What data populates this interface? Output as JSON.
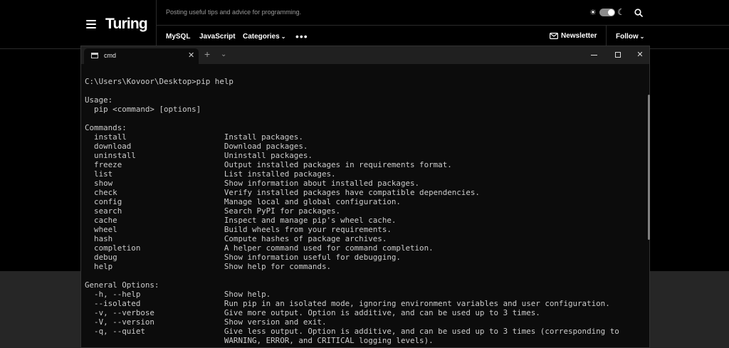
{
  "header": {
    "logo": "Turing",
    "tagline": "Posting useful tips and advice for programming.",
    "nav": [
      "MySQL",
      "JavaScript",
      "Categories"
    ],
    "newsletter_label": "Newsletter",
    "follow_label": "Follow"
  },
  "icons": {
    "menu": "hamburger-icon",
    "theme": [
      "sun-icon",
      "moon-icon"
    ],
    "search": "search-icon",
    "more": "more-icon",
    "mail": "mail-icon"
  },
  "terminal": {
    "tab_title": "cmd",
    "prompt": "C:\\Users\\Kovoor\\Desktop>pip help",
    "usage_heading": "Usage:",
    "usage_line": "  pip <command> [options]",
    "commands_heading": "Commands:",
    "commands": [
      {
        "name": "install",
        "desc": "Install packages."
      },
      {
        "name": "download",
        "desc": "Download packages."
      },
      {
        "name": "uninstall",
        "desc": "Uninstall packages."
      },
      {
        "name": "freeze",
        "desc": "Output installed packages in requirements format."
      },
      {
        "name": "list",
        "desc": "List installed packages."
      },
      {
        "name": "show",
        "desc": "Show information about installed packages."
      },
      {
        "name": "check",
        "desc": "Verify installed packages have compatible dependencies."
      },
      {
        "name": "config",
        "desc": "Manage local and global configuration."
      },
      {
        "name": "search",
        "desc": "Search PyPI for packages."
      },
      {
        "name": "cache",
        "desc": "Inspect and manage pip's wheel cache."
      },
      {
        "name": "wheel",
        "desc": "Build wheels from your requirements."
      },
      {
        "name": "hash",
        "desc": "Compute hashes of package archives."
      },
      {
        "name": "completion",
        "desc": "A helper command used for command completion."
      },
      {
        "name": "debug",
        "desc": "Show information useful for debugging."
      },
      {
        "name": "help",
        "desc": "Show help for commands."
      }
    ],
    "options_heading": "General Options:",
    "options": [
      {
        "name": "-h, --help",
        "desc": "Show help."
      },
      {
        "name": "--isolated",
        "desc": "Run pip in an isolated mode, ignoring environment variables and user configuration."
      },
      {
        "name": "-v, --verbose",
        "desc": "Give more output. Option is additive, and can be used up to 3 times."
      },
      {
        "name": "-V, --version",
        "desc": "Show version and exit."
      },
      {
        "name": "-q, --quiet",
        "desc": "Give less output. Option is additive, and can be used up to 3 times (corresponding to"
      },
      {
        "name": "",
        "desc": "WARNING, ERROR, and CRITICAL logging levels)."
      }
    ]
  }
}
